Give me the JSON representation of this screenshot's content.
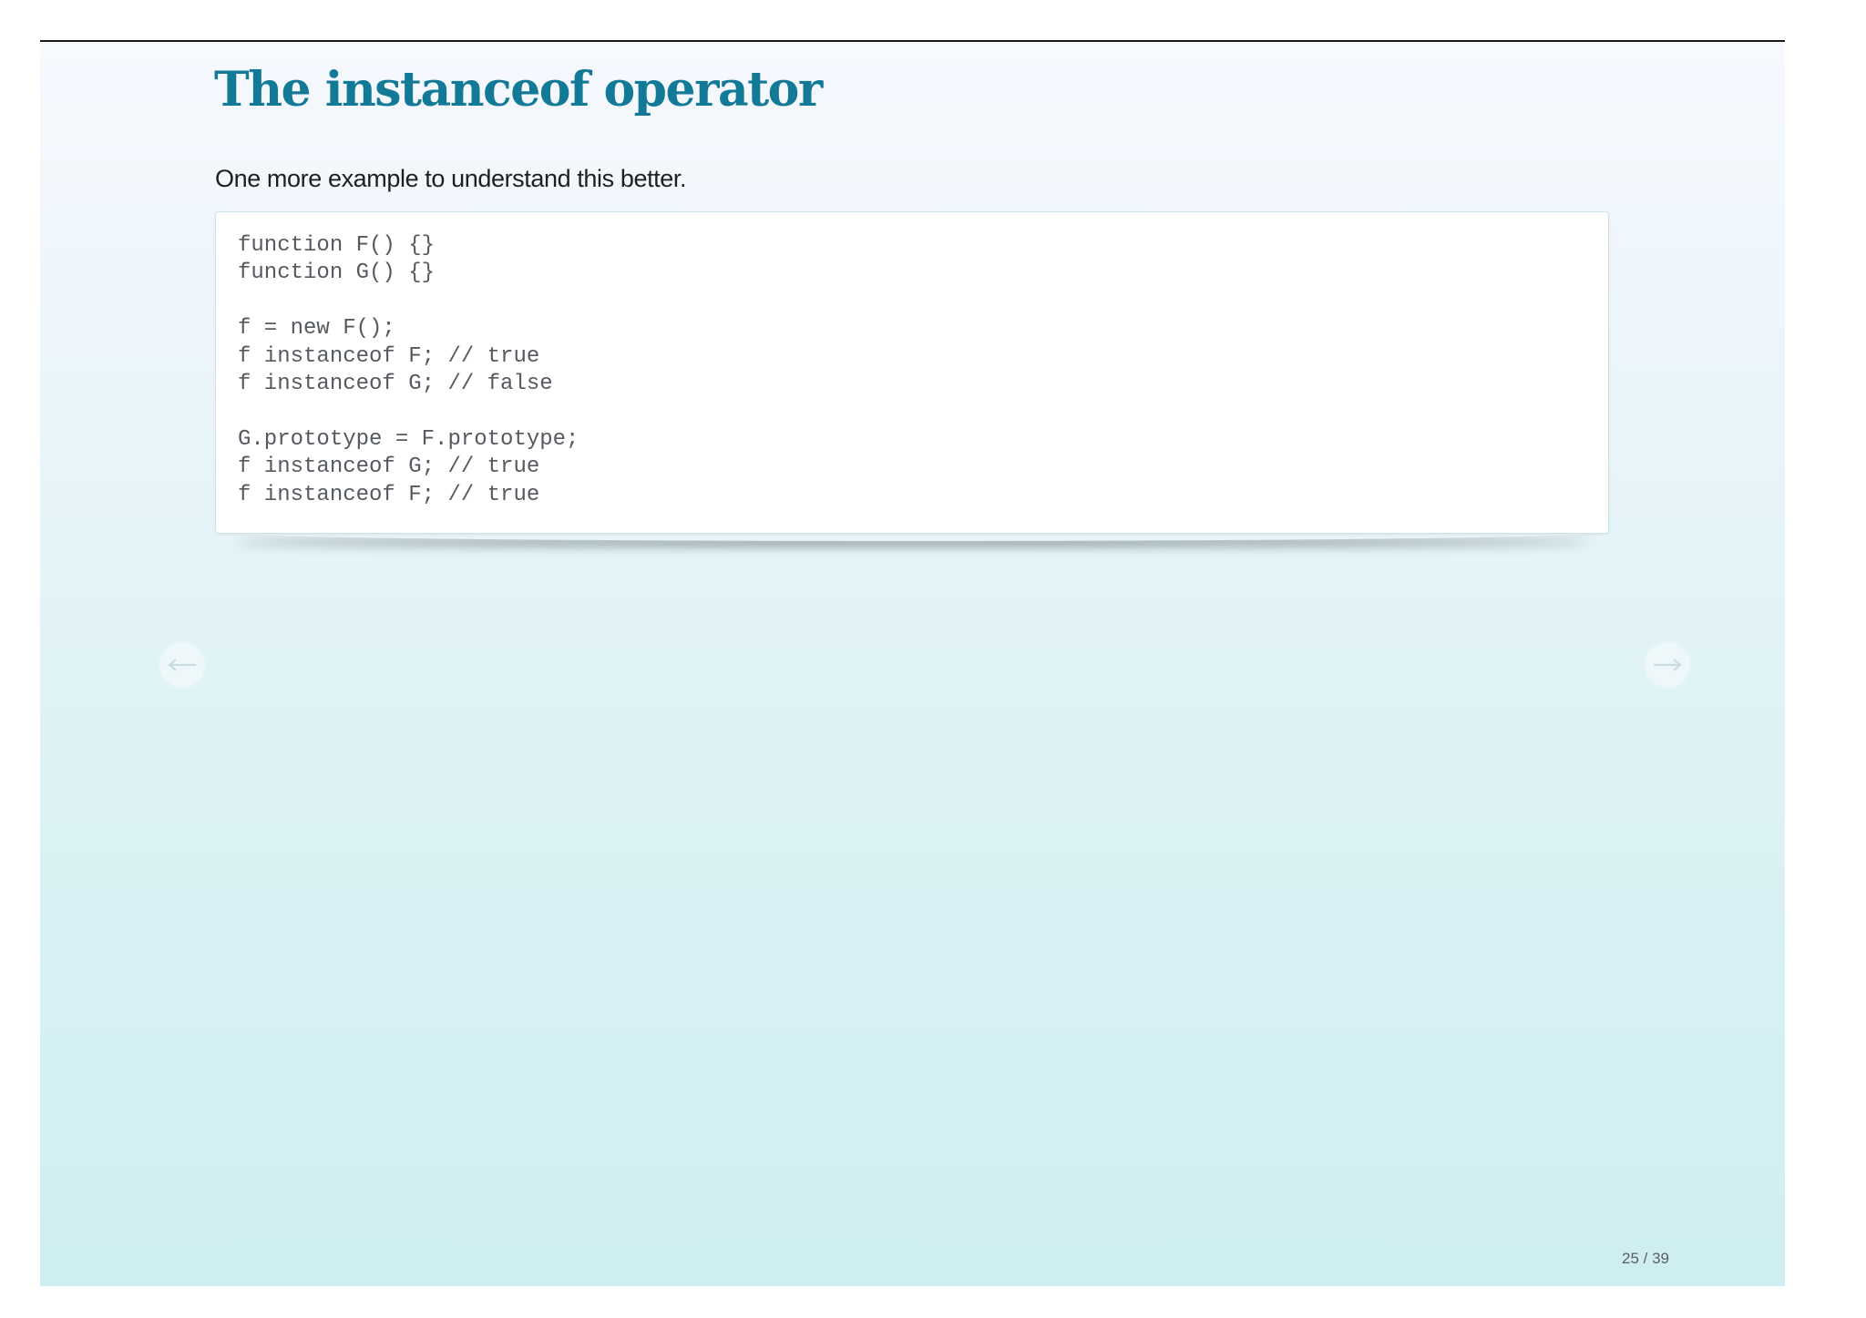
{
  "slide": {
    "title": "The instanceof operator",
    "subtitle": "One more example to understand this better.",
    "code_lines": [
      "function F() {}",
      "function G() {}",
      "",
      "f = new F();",
      "f instanceof F; // true",
      "f instanceof G; // false",
      "",
      "G.prototype = F.prototype;",
      "f instanceof G; // true",
      "f instanceof F; // true"
    ]
  },
  "navigation": {
    "prev_icon": "arrow-left-icon",
    "next_icon": "arrow-right-icon",
    "page_counter": "25 / 39"
  },
  "colors": {
    "title": "#127a96",
    "code_text": "#555a60",
    "nav_arrow": "#c8dde2"
  }
}
